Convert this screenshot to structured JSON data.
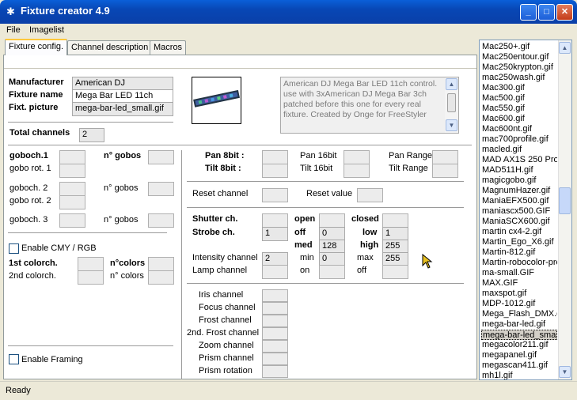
{
  "window": {
    "title": "Fixture creator 4.9"
  },
  "menu": {
    "file": "File",
    "imagelist": "Imagelist"
  },
  "tabs": [
    "Fixture config.",
    "Channel description",
    "Macros"
  ],
  "fixture": {
    "manufacturer_label": "Manufacturer",
    "manufacturer": "American DJ",
    "name_label": "Fixture name",
    "name": "Mega Bar LED 11ch",
    "picture_label": "Fixt. picture",
    "picture": "mega-bar-led_small.gif",
    "description": "American DJ Mega Bar LED 11ch control. use with 3xAmerican DJ Mega Bar 3ch patched before this one for every real fixture. Created by Onge for FreeStyler"
  },
  "channels": {
    "total_label": "Total channels",
    "total": "2"
  },
  "gobos": {
    "goboch1": "goboch.1",
    "ngobos1": "n° gobos",
    "gobo_rot1": "gobo rot. 1",
    "goboch2": "goboch. 2",
    "ngobos2": "n° gobos",
    "gobo_rot2": "gobo rot. 2",
    "goboch3": "goboch. 3",
    "ngobos3": "n° gobos"
  },
  "cmy": {
    "enable_label": "Enable CMY / RGB",
    "colorch1": "1st colorch.",
    "colorch2": "2nd colorch.",
    "ncolors1": "n°colors",
    "ncolors2": "n° colors"
  },
  "framing": {
    "enable_label": "Enable Framing"
  },
  "pantilt": {
    "pan8": "Pan 8bit :",
    "tilt8": "Tilt 8bit :",
    "pan16": "Pan 16bit",
    "tilt16": "Tilt 16bit",
    "panrange": "Pan Range",
    "tiltrange": "Tilt Range"
  },
  "reset": {
    "channel_label": "Reset channel",
    "value_label": "Reset value"
  },
  "shutter": {
    "shutter_label": "Shutter ch.",
    "strobe_label": "Strobe ch.",
    "strobe_value": "1",
    "intensity_label": "Intensity channel",
    "intensity_value": "2",
    "lamp_label": "Lamp channel",
    "open": "open",
    "off": "off",
    "off_value": "0",
    "med": "med",
    "med_value": "128",
    "min": "min",
    "min_value": "0",
    "on": "on",
    "closed": "closed",
    "low": "low",
    "low_value": "1",
    "high": "high",
    "high_value": "255",
    "max": "max",
    "max_value": "255",
    "off2": "off"
  },
  "other_channels": [
    "Iris channel",
    "Focus channel",
    "Frost channel",
    "2nd. Frost channel",
    "Zoom channel",
    "Prism channel",
    "Prism rotation"
  ],
  "filelist": [
    "Mac250+.gif",
    "Mac250entour.gif",
    "Mac250krypton.gif",
    "mac250wash.gif",
    "Mac300.gif",
    "Mac500.gif",
    "Mac550.gif",
    "Mac600.gif",
    "Mac600nt.gif",
    "mac700profile.gif",
    "macled.gif",
    "MAD AX1S 250 Pro",
    "MAD511H.gif",
    "magicgobo.gif",
    "MagnumHazer.gif",
    "ManiaEFX500.gif",
    "maniascx500.GIF",
    "ManiaSCX600.gif",
    "martin cx4-2.gif",
    "Martin_Ego_X6.gif",
    "Martin-812.gif",
    "Martin-robocolor-pro",
    "ma-small.GIF",
    "MAX.GIF",
    "maxspot.gif",
    "MDP-1012.gif",
    "Mega_Flash_DMX.g",
    "mega-bar-led.gif",
    "mega-bar-led_small.g",
    "megacolor211.gif",
    "megapanel.gif",
    "megascan411.gif",
    "mh1l.gif"
  ],
  "filelist_selected": "mega-bar-led_small.g",
  "status": "Ready"
}
